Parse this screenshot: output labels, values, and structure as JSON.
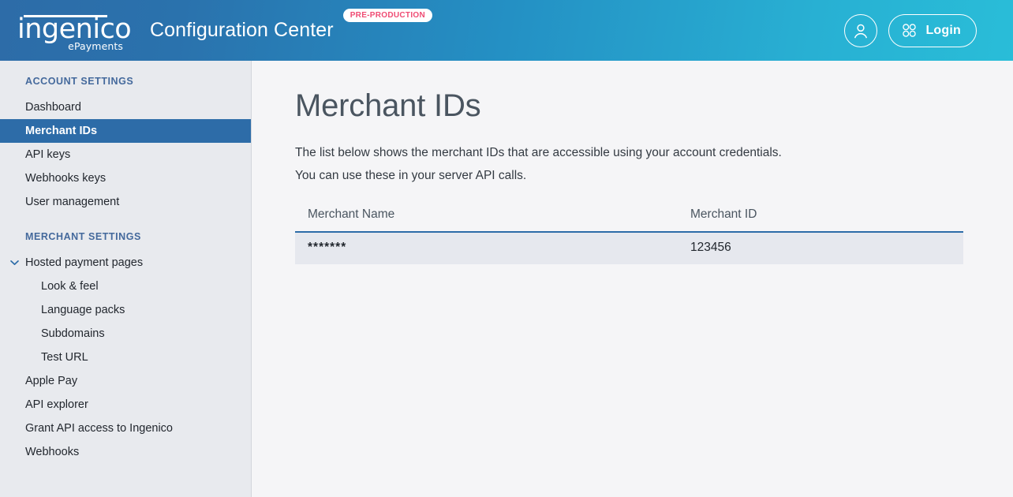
{
  "header": {
    "logo": {
      "word": "ingenico",
      "sub": "ePayments",
      "bar_icon": "logo-bar-icon"
    },
    "app_title": "Configuration Center",
    "env_badge": "PRE-PRODUCTION",
    "avatar_icon": "user-avatar-icon",
    "apps_icon": "four-dots-grid-icon",
    "login_label": "Login",
    "gradient_from": "#2d6ca8",
    "gradient_to": "#29bdd8",
    "badge_text_color": "#ef4b73"
  },
  "sidebar": {
    "background": "#e8eaee",
    "active_color": "#2d6ca8",
    "section_title_color": "#44699c",
    "sections": [
      {
        "title": "ACCOUNT SETTINGS",
        "items": [
          {
            "label": "Dashboard",
            "active": false,
            "level": 0
          },
          {
            "label": "Merchant IDs",
            "active": true,
            "level": 0
          },
          {
            "label": "API keys",
            "active": false,
            "level": 0
          },
          {
            "label": "Webhooks keys",
            "active": false,
            "level": 0
          },
          {
            "label": "User management",
            "active": false,
            "level": 0
          }
        ]
      },
      {
        "title": "MERCHANT SETTINGS",
        "items": [
          {
            "label": "Hosted payment pages",
            "active": false,
            "level": 0,
            "expanded": true,
            "icon": "chevron-down-icon"
          },
          {
            "label": "Look & feel",
            "active": false,
            "level": 1
          },
          {
            "label": "Language packs",
            "active": false,
            "level": 1
          },
          {
            "label": "Subdomains",
            "active": false,
            "level": 1
          },
          {
            "label": "Test URL",
            "active": false,
            "level": 1
          },
          {
            "label": "Apple Pay",
            "active": false,
            "level": 0
          },
          {
            "label": "API explorer",
            "active": false,
            "level": 0
          },
          {
            "label": "Grant API access to Ingenico",
            "active": false,
            "level": 0
          },
          {
            "label": "Webhooks",
            "active": false,
            "level": 0
          }
        ]
      }
    ]
  },
  "main": {
    "title": "Merchant IDs",
    "description_line1": "The list below shows the merchant IDs that are accessible using your account credentials.",
    "description_line2": "You can use these in your server API calls.",
    "table": {
      "columns": [
        "Merchant Name",
        "Merchant ID"
      ],
      "rows": [
        {
          "merchant_name": "*******",
          "merchant_id": "123456"
        }
      ],
      "header_border_color": "#2d6ca8",
      "row_background": "#e6e8ee"
    }
  }
}
